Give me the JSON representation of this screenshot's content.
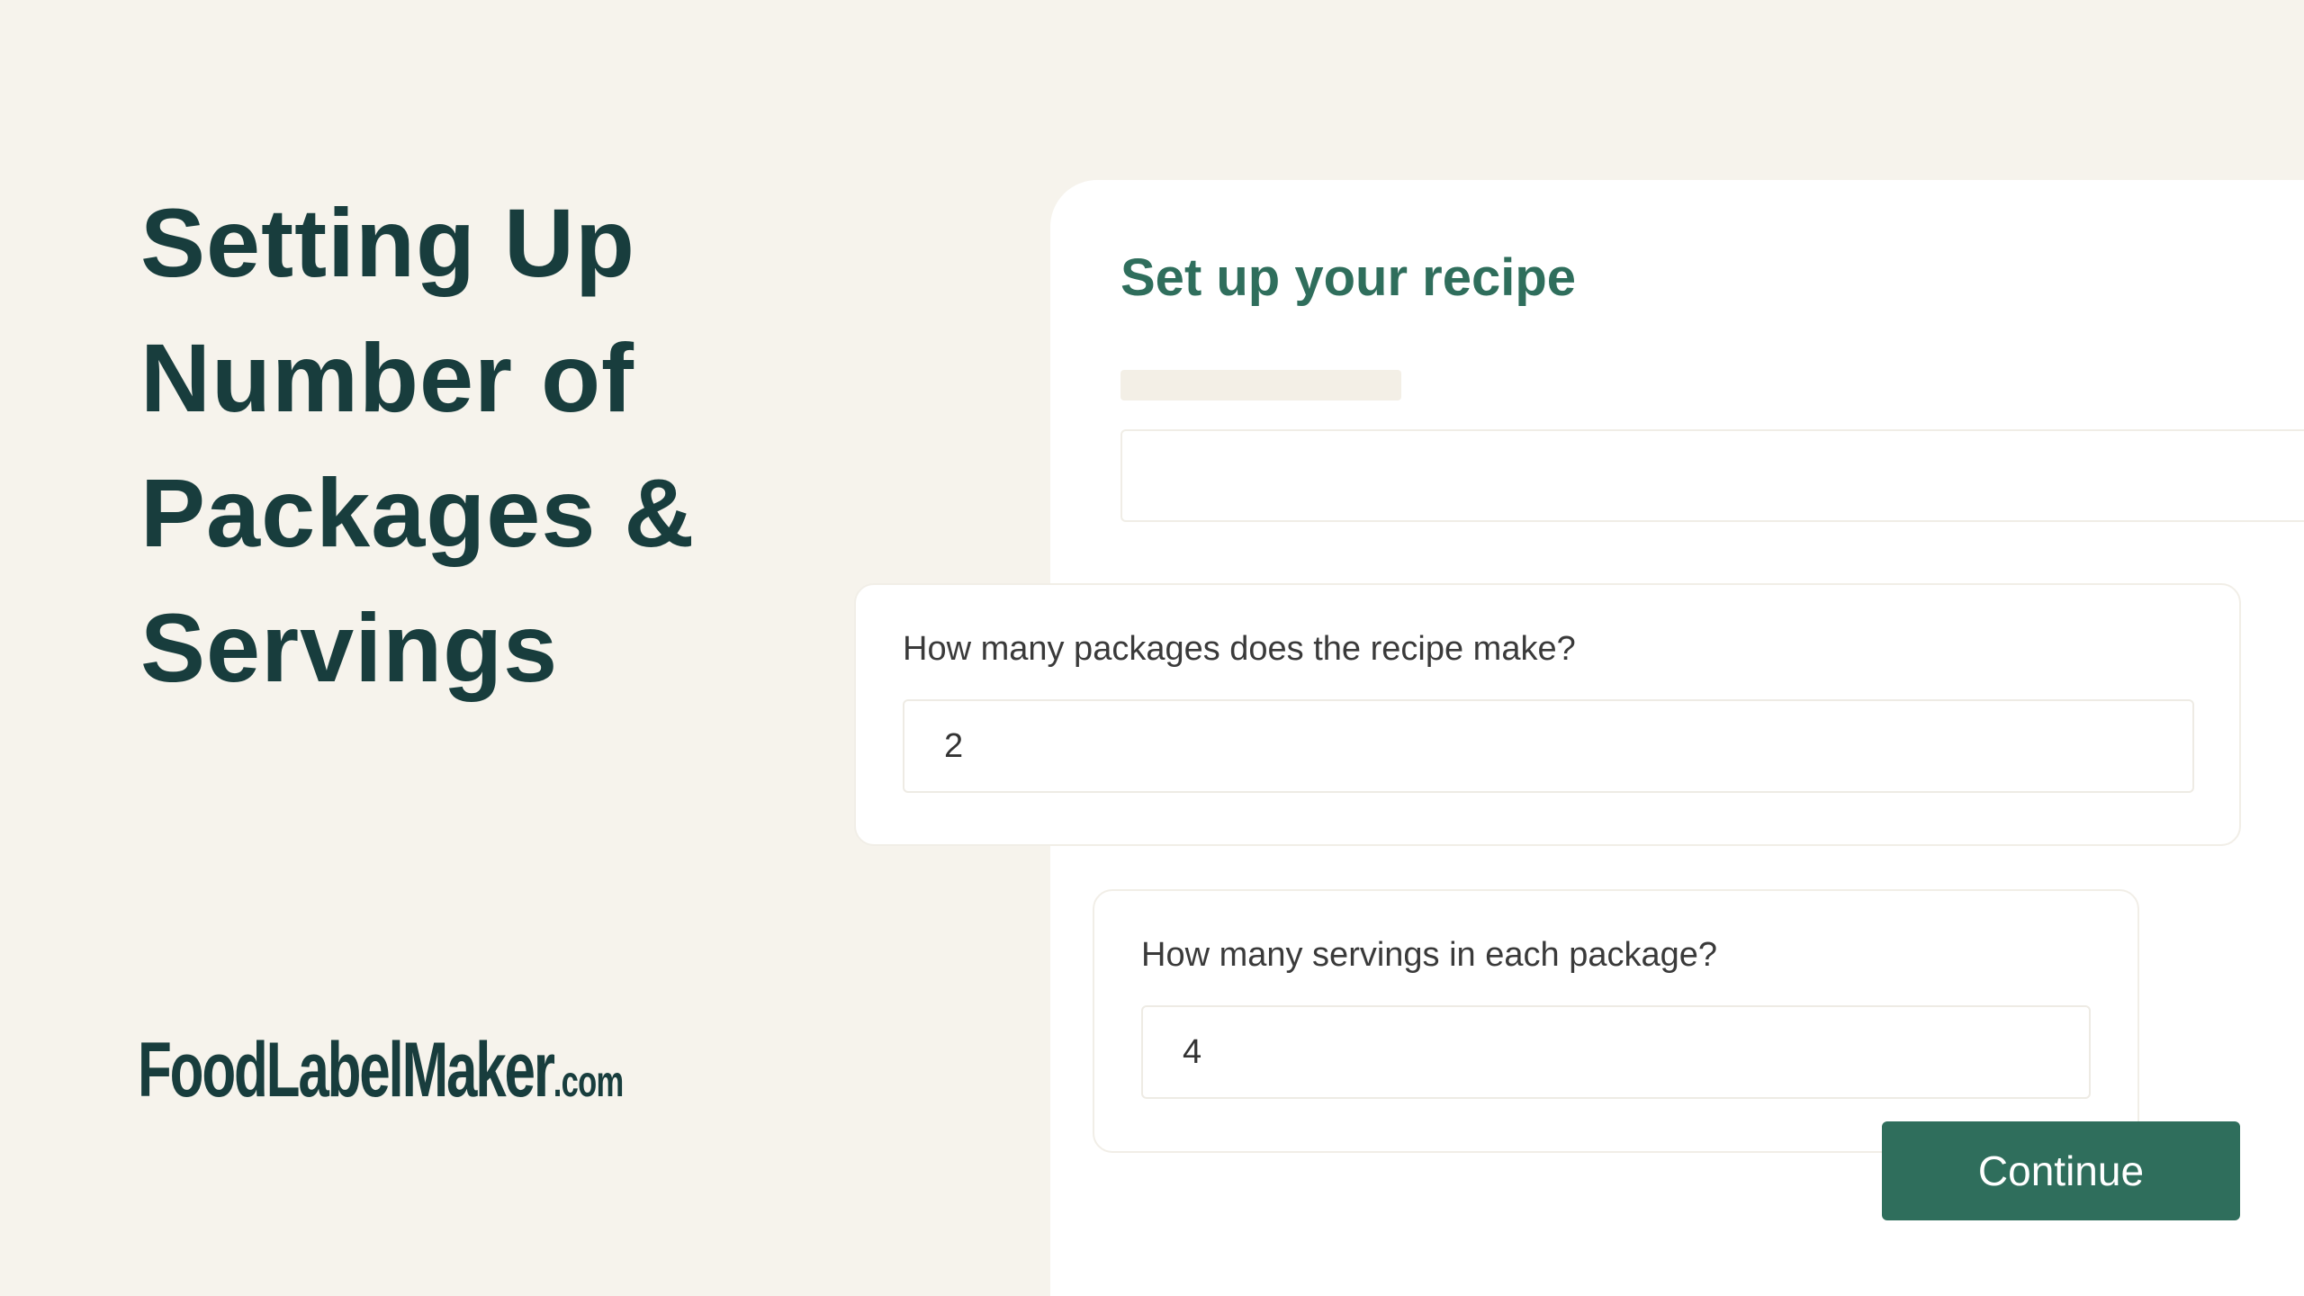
{
  "heading": {
    "lines": [
      "Setting Up",
      "Number of",
      "Packages &",
      "Servings"
    ]
  },
  "logo": {
    "main": "FoodLabelMaker",
    "suffix": ".com"
  },
  "panel": {
    "title": "Set up your recipe"
  },
  "packages": {
    "question": "How many packages does the recipe make?",
    "value": "2"
  },
  "servings": {
    "question": "How many servings in each package?",
    "value": "4"
  },
  "actions": {
    "continue_label": "Continue"
  },
  "colors": {
    "background": "#f6f3ec",
    "heading": "#183d3d",
    "accent": "#2f6e5c",
    "panel": "#ffffff"
  }
}
